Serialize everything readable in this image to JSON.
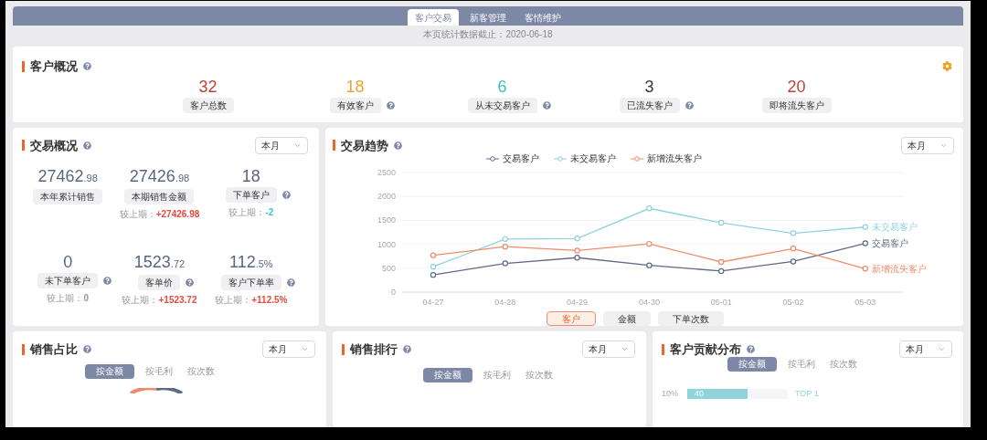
{
  "tabs": [
    {
      "label": "客户交易",
      "selected": true
    },
    {
      "label": "新客管理",
      "selected": false
    },
    {
      "label": "客情维护",
      "selected": false
    }
  ],
  "data_date": "本页统计数据截止：2020-06-18",
  "customer_overview": {
    "title": "客户概况",
    "help": true,
    "settings": true,
    "stats": [
      {
        "value": "32",
        "label": "客户总数",
        "color": "#c0423a",
        "help": false
      },
      {
        "value": "18",
        "label": "有效客户",
        "color": "#eba534",
        "help": true
      },
      {
        "value": "6",
        "label": "从未交易客户",
        "color": "#3cc0c8",
        "help": true
      },
      {
        "value": "3",
        "label": "已流失客户",
        "color": "#2e3a4a",
        "help": true
      },
      {
        "value": "20",
        "label": "即将流失客户",
        "color": "#c0423a",
        "help": false
      }
    ]
  },
  "transaction_overview": {
    "title": "交易概况",
    "help": true,
    "period": "本月",
    "stats": [
      {
        "value": "27462",
        "decimal": ".98",
        "label": "本年累计销售",
        "help": false
      },
      {
        "value": "27426",
        "decimal": ".98",
        "label": "本期销售金额",
        "help": false,
        "compare": "较上期：",
        "delta": "+27426.98",
        "color": "#e84a3c"
      },
      {
        "value": "18",
        "label": "下单客户",
        "help": true,
        "compare": "较上期：",
        "delta": "-2",
        "color": "#3cc0c8"
      },
      {
        "value": "0",
        "label": "未下单客户",
        "help": true,
        "compare": "较上期：",
        "delta": "0",
        "color": "#999999"
      },
      {
        "value": "1523",
        "decimal": ".72",
        "label": "客单价",
        "help": true,
        "compare": "较上期：",
        "delta": "+1523.72",
        "color": "#e84a3c"
      },
      {
        "value": "112",
        "decimal": ".5%",
        "label": "客户下单率",
        "help": true,
        "compare": "较上期：",
        "delta": "+112.5%",
        "color": "#e84a3c"
      }
    ]
  },
  "transaction_trend": {
    "title": "交易趋势",
    "help": true,
    "period": "本月",
    "chart_data": {
      "type": "line",
      "grid": true,
      "categories": [
        "04-27",
        "04-28",
        "04-29",
        "04-30",
        "05-01",
        "05-02",
        "05-03"
      ],
      "ylim": [
        0,
        2500
      ],
      "yticks": [
        0,
        500,
        1000,
        1500,
        2000,
        2500
      ],
      "series": [
        {
          "name": "交易客户",
          "color": "#5d6b85",
          "marker": "circle",
          "values": [
            360,
            600,
            720,
            560,
            440,
            640,
            1020
          ]
        },
        {
          "name": "未交易客户",
          "color": "#8fd3dc",
          "marker": "circle",
          "values": [
            530,
            1110,
            1120,
            1750,
            1450,
            1230,
            1360
          ]
        },
        {
          "name": "新增流失客户",
          "color": "#ef8c6a",
          "marker": "circle",
          "values": [
            770,
            950,
            870,
            1010,
            630,
            910,
            490
          ]
        }
      ]
    },
    "end_labels": [
      "未交易客户",
      "交易客户",
      "新增流失客户"
    ],
    "metrics": [
      {
        "label": "客户",
        "selected": true
      },
      {
        "label": "金额",
        "selected": false
      },
      {
        "label": "下单次数",
        "selected": false
      }
    ]
  },
  "sales_share": {
    "title": "销售占比",
    "help": true,
    "period": "本月",
    "modes": [
      {
        "label": "按金额",
        "selected": true
      },
      {
        "label": "按毛利",
        "selected": false
      },
      {
        "label": "按次数",
        "selected": false
      }
    ]
  },
  "sales_ranking": {
    "title": "销售排行",
    "help": true,
    "period": "本月",
    "modes": [
      {
        "label": "按金额",
        "selected": true
      },
      {
        "label": "按毛利",
        "selected": false
      },
      {
        "label": "按次数",
        "selected": false
      }
    ]
  },
  "customer_contribution": {
    "title": "客户贡献分布",
    "help": true,
    "period": "本月",
    "modes": [
      {
        "label": "按金额",
        "selected": true
      },
      {
        "label": "按毛利",
        "selected": false
      },
      {
        "label": "按次数",
        "selected": false
      }
    ],
    "rows": [
      {
        "share": "10%",
        "value": "40",
        "rank": "TOP 1",
        "level": 0.6
      }
    ]
  }
}
